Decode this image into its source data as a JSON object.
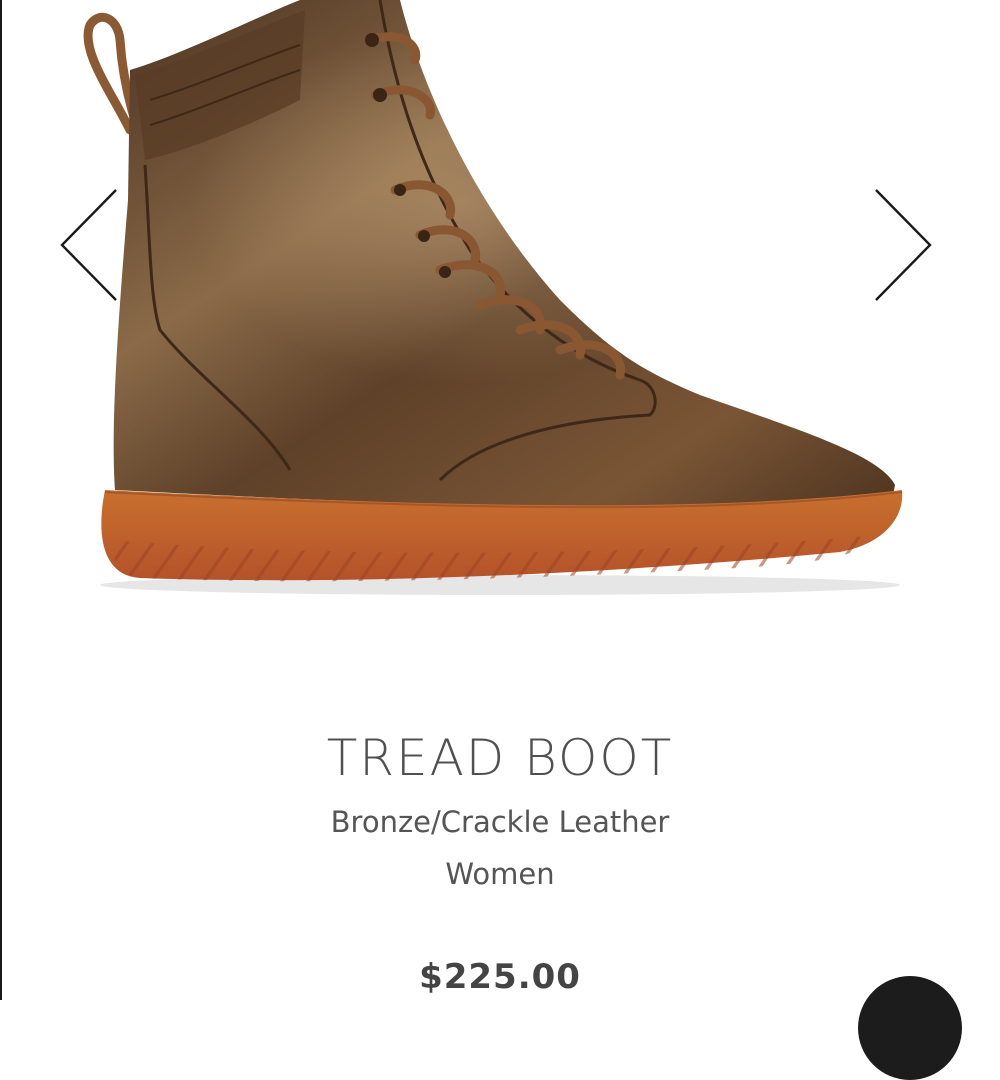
{
  "product": {
    "title": "TREAD BOOT",
    "variant": "Bronze/Crackle Leather",
    "gender": "Women",
    "price": "$225.00"
  },
  "gallery": {
    "prev_icon": "chevron-left-icon",
    "next_icon": "chevron-right-icon",
    "image_subject": "bronze high-top lace-up boot with gum sole"
  },
  "chat": {
    "icon": "chat-bubble-icon"
  },
  "colors": {
    "leather": "#6b4a2c",
    "sole": "#c2612c",
    "text": "#505050",
    "arrow": "#1a1a1a"
  }
}
